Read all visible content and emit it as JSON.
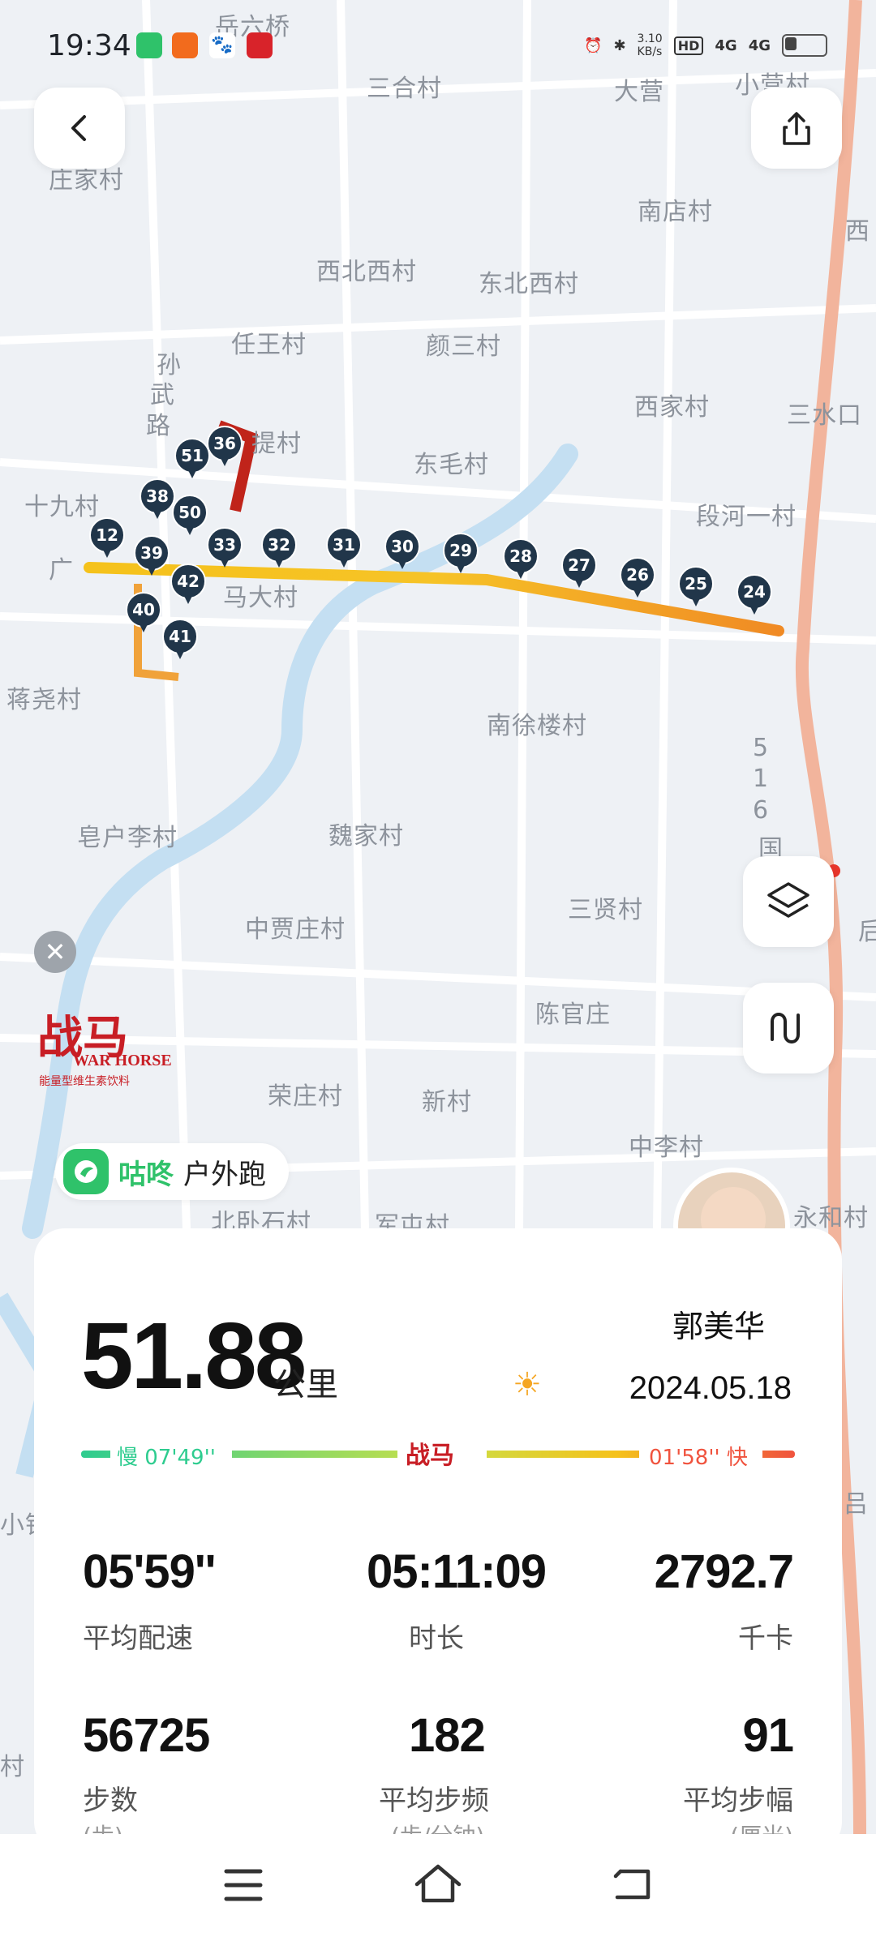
{
  "status": {
    "time": "19:34",
    "net_speed": "3.10",
    "net_unit": "KB/s",
    "hd": "HD",
    "signal1": "4G",
    "signal2": "4G"
  },
  "map": {
    "villages": [
      "岳六桥",
      "三合村",
      "大营",
      "小营村",
      "庄家村",
      "南店村",
      "西",
      "西北西村",
      "东北西村",
      "任王村",
      "颜三村",
      "孙",
      "武",
      "路",
      "西家村",
      "三水口",
      "提村",
      "东毛村",
      "十九村",
      "段河一村",
      "广",
      "马大村",
      "蒋尧村",
      "南徐楼村",
      "5",
      "1",
      "6",
      "国",
      "皂户李村",
      "魏家村",
      "三贤村",
      "中贾庄村",
      "陈官庄",
      "荣庄村",
      "新村",
      "中李村",
      "北卧石村",
      "军屯村",
      "永和村",
      "后",
      "小铁",
      "吕",
      "村"
    ],
    "markers": [
      "12",
      "38",
      "50",
      "51",
      "36",
      "39",
      "42",
      "40",
      "41",
      "33",
      "32",
      "31",
      "30",
      "29",
      "28",
      "27",
      "26",
      "25",
      "24"
    ]
  },
  "brand": {
    "logo_text": "战马",
    "logo_sub": "WAR HORSE",
    "logo_tagline": "能量型维生素饮料",
    "app_name": "咕咚",
    "app_sub": "户外跑"
  },
  "summary": {
    "distance": "51.88",
    "distance_unit": "公里",
    "user_name": "郭美华",
    "date": "2024.05.18",
    "pace_slow_label": "慢 07'49''",
    "pace_fast_label": "01'58'' 快"
  },
  "stats": [
    {
      "value": "05'59''",
      "label": "平均配速"
    },
    {
      "value": "05:11:09",
      "label": "时长"
    },
    {
      "value": "2792.7",
      "label": "千卡"
    },
    {
      "value": "56725",
      "label": "步数",
      "sub": "(步)"
    },
    {
      "value": "182",
      "label": "平均步频",
      "sub": "(步/分钟)"
    },
    {
      "value": "91",
      "label": "平均步幅",
      "sub": "(厘米)"
    }
  ],
  "colors": {
    "route_start": "#f5c21b",
    "route_end": "#f08a24",
    "marker": "#21364a",
    "pace_slow": "#2ecc8f",
    "pace_fast": "#f0533e",
    "app_green": "#2fc26a"
  },
  "nav": {
    "menu_icon": "menu-icon",
    "home_icon": "home-icon",
    "back_icon": "back-icon"
  }
}
